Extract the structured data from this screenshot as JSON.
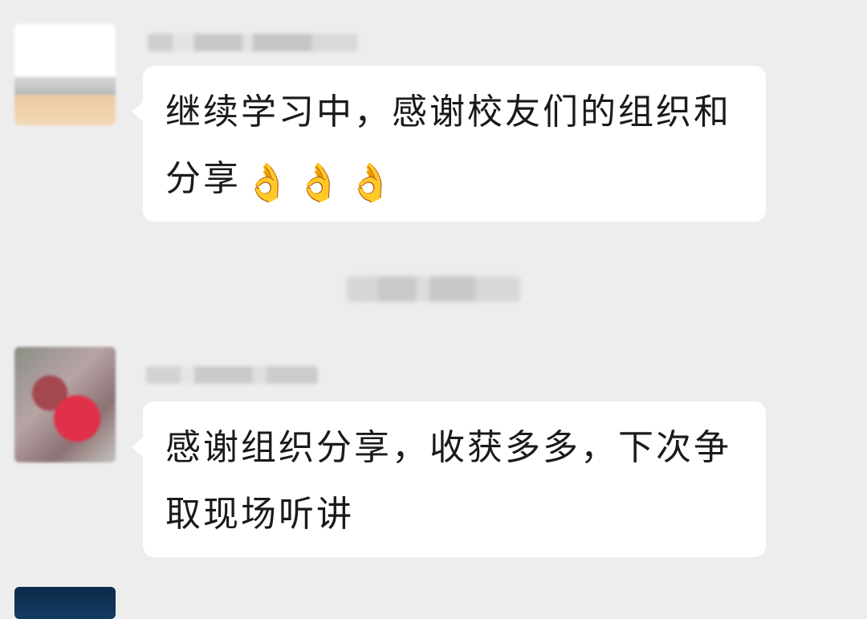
{
  "messages": [
    {
      "text": "继续学习中，感谢校友们的组织和分享",
      "emojis": [
        "👌",
        "👌",
        "👌"
      ]
    },
    {
      "text": "感谢组织分享，收获多多，下次争取现场听讲"
    }
  ]
}
